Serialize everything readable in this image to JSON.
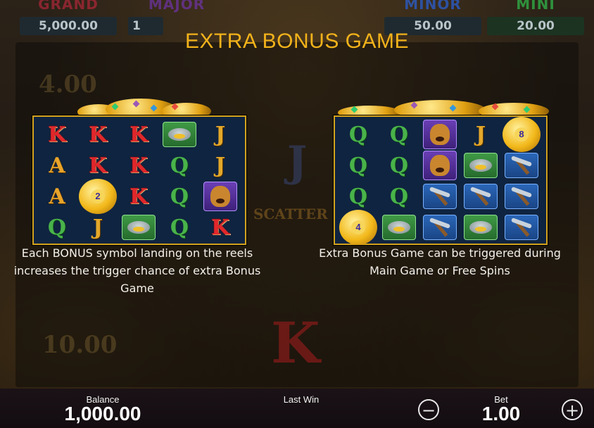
{
  "jackpots": [
    {
      "name": "GRAND",
      "value": "5,000.00",
      "color": "#e02a4a"
    },
    {
      "name": "MAJOR",
      "value": "1",
      "color": "#8a3ad8"
    },
    {
      "name": "MINOR",
      "value": "50.00",
      "color": "#2a62e0"
    },
    {
      "name": "MINI",
      "value": "20.00",
      "color": "#34c24a"
    }
  ],
  "title": "EXTRA BONUS GAME",
  "background": {
    "ghost_values": [
      "4.00",
      "10.00"
    ],
    "ghost_letters": [
      "J",
      "K"
    ],
    "ghost_scatter": "SCATTER"
  },
  "left_panel": {
    "grid": [
      [
        "K",
        "K",
        "K",
        "pan",
        "J"
      ],
      [
        "A",
        "K",
        "K",
        "Q",
        "J"
      ],
      [
        "A",
        "bonus",
        "K",
        "Q",
        "dog"
      ],
      [
        "Q",
        "J",
        "pan",
        "Q",
        "K"
      ]
    ],
    "bonus_value": "2",
    "caption": [
      "Each BONUS symbol landing on the reels",
      "increases the trigger chance of extra Bonus",
      "Game"
    ]
  },
  "right_panel": {
    "grid": [
      [
        "Q",
        "Q",
        "dog",
        "J",
        "bonus"
      ],
      [
        "Q",
        "Q",
        "dog",
        "pan",
        "pick"
      ],
      [
        "Q",
        "Q",
        "pick",
        "pick",
        "pick"
      ],
      [
        "bonus",
        "pan",
        "pick",
        "pan",
        "pick"
      ]
    ],
    "bonus_values": [
      "8",
      "4"
    ],
    "caption": [
      "Extra Bonus Game can be triggered during",
      "Main Game or Free Spins"
    ]
  },
  "footer": {
    "balance_label": "Balance",
    "balance_value": "1,000.00",
    "last_win_label": "Last Win",
    "bet_label": "Bet",
    "bet_value": "1.00",
    "minus_symbol": "−",
    "plus_symbol": "+"
  }
}
